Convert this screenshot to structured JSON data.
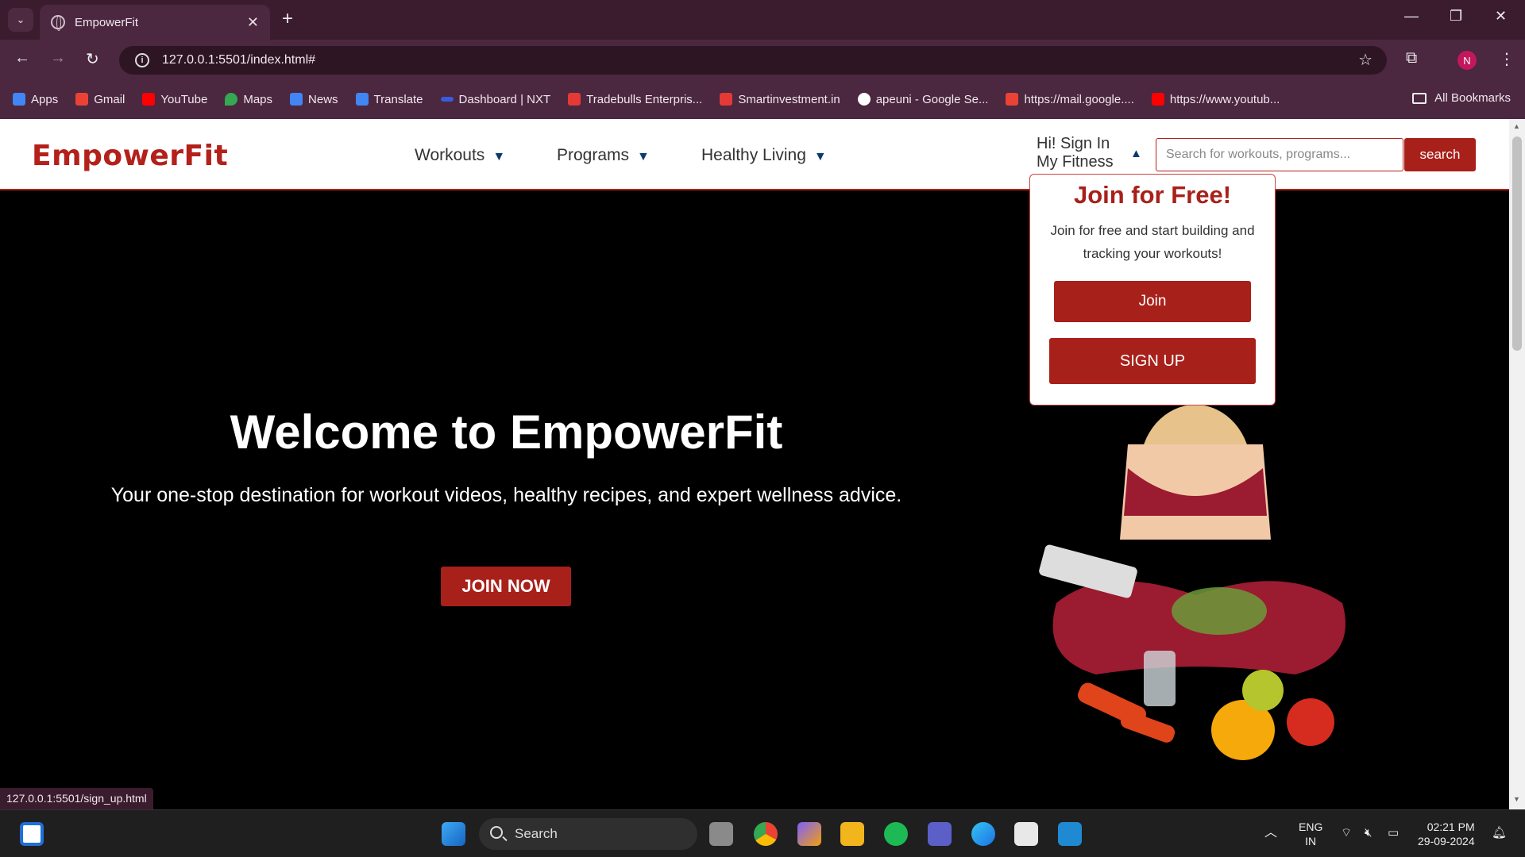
{
  "browser": {
    "tab_title": "EmpowerFit",
    "tab_close": "✕",
    "new_tab": "+",
    "url": "127.0.0.1:5501/index.html#",
    "profile_initial": "N",
    "bookmarks": [
      {
        "label": "Apps",
        "color": "#4285f4"
      },
      {
        "label": "Gmail",
        "color": "#ea4335"
      },
      {
        "label": "YouTube",
        "color": "#ff0000"
      },
      {
        "label": "Maps",
        "color": "#34a853"
      },
      {
        "label": "News",
        "color": "#4285f4"
      },
      {
        "label": "Translate",
        "color": "#4285f4"
      },
      {
        "label": "Dashboard | NXT",
        "color": "#3b5bdb"
      },
      {
        "label": "Tradebulls Enterpris...",
        "color": "#e53935"
      },
      {
        "label": "Smartinvestment.in",
        "color": "#e53935"
      },
      {
        "label": "apeuni - Google Se...",
        "color": "#ffffff"
      },
      {
        "label": "https://mail.google....",
        "color": "#ea4335"
      },
      {
        "label": "https://www.youtub...",
        "color": "#ff0000"
      }
    ],
    "all_bookmarks": "All Bookmarks",
    "status_url": "127.0.0.1:5501/sign_up.html"
  },
  "site": {
    "logo": "EmpowerFit",
    "nav": [
      {
        "label": "Workouts",
        "caret": "▼"
      },
      {
        "label": "Programs",
        "caret": "▼"
      },
      {
        "label": "Healthy Living",
        "caret": "▼"
      }
    ],
    "account_line1": "Hi! Sign In",
    "account_line2": "My Fitness",
    "account_caret": "▲",
    "search_placeholder": "Search for workouts, programs...",
    "search_button": "search",
    "dropdown": {
      "title": "Join for Free!",
      "text": "Join for free and start building and tracking your workouts!",
      "join_button": "Join",
      "signup_button": "SIGN UP"
    },
    "hero": {
      "title": "Welcome to EmpowerFit",
      "subtitle": "Your one-stop destination for workout videos, healthy recipes, and expert wellness advice.",
      "cta": "JOIN NOW"
    }
  },
  "taskbar": {
    "search_label": "Search",
    "lang_line1": "ENG",
    "lang_line2": "IN",
    "time": "02:21 PM",
    "date": "29-09-2024"
  },
  "colors": {
    "brand": "#b3211a",
    "button": "#a8201a",
    "chrome_dark": "#3a1c2e",
    "chrome": "#4b2740"
  }
}
